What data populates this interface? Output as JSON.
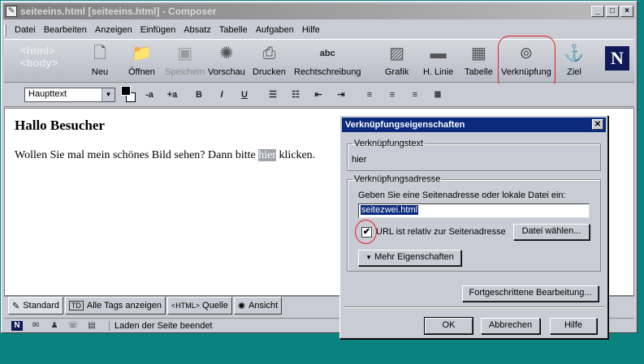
{
  "window": {
    "title": "seiteeins.html [seiteeins.html] - Composer",
    "minimize": "_",
    "maximize": "□",
    "close": "×"
  },
  "menu": [
    "Datei",
    "Bearbeiten",
    "Anzeigen",
    "Einfügen",
    "Absatz",
    "Tabelle",
    "Aufgaben",
    "Hilfe"
  ],
  "toolbar": {
    "watermark": [
      "<html>",
      "<body>"
    ],
    "buttons": [
      {
        "label": "Neu",
        "icon": "new-page-icon"
      },
      {
        "label": "Öffnen",
        "icon": "folder-icon"
      },
      {
        "label": "Speichern",
        "icon": "save-icon",
        "disabled": true
      },
      {
        "label": "Vorschau",
        "icon": "preview-icon"
      },
      {
        "label": "Drucken",
        "icon": "printer-icon"
      },
      {
        "label": "Rechtschreibung",
        "icon": "spellcheck-icon"
      },
      {
        "label": "Grafik",
        "icon": "image-icon"
      },
      {
        "label": "H. Linie",
        "icon": "horizontal-line-icon"
      },
      {
        "label": "Tabelle",
        "icon": "table-icon"
      },
      {
        "label": "Verknüpfung",
        "icon": "link-icon"
      },
      {
        "label": "Ziel",
        "icon": "anchor-icon"
      }
    ],
    "logo": "N"
  },
  "format": {
    "paragraph_style": "Haupttext",
    "buttons": [
      "-a",
      "+a",
      "B",
      "I",
      "U"
    ]
  },
  "document": {
    "heading": "Hallo Besucher",
    "text_before": "Wollen Sie mal mein schönes Bild sehen? Dann bitte ",
    "selected": "hier",
    "text_after": " klicken."
  },
  "tabs": [
    {
      "label": "Standard",
      "icon": "pencil-icon"
    },
    {
      "label": "Alle Tags anzeigen",
      "icon": "TD"
    },
    {
      "label": "Quelle",
      "icon": "<HTML>"
    },
    {
      "label": "Ansicht",
      "icon": "preview-icon"
    }
  ],
  "status": {
    "text": "Laden der Seite beendet"
  },
  "dialog": {
    "title": "Verknüpfungseigenschaften",
    "link_text_legend": "Verknüpfungstext",
    "link_text": "hier",
    "link_address_legend": "Verknüpfungsadresse",
    "hint": "Geben Sie eine Seitenadresse oder lokale Datei ein:",
    "url": "seitezwei.html",
    "relative_label": "URL ist relativ zur Seitenadresse",
    "relative_checked": true,
    "choose_file": "Datei wählen...",
    "more_props": "Mehr Eigenschaften",
    "advanced": "Fortgeschrittene Bearbeitung...",
    "ok": "OK",
    "cancel": "Abbrechen",
    "help": "Hilfe"
  }
}
